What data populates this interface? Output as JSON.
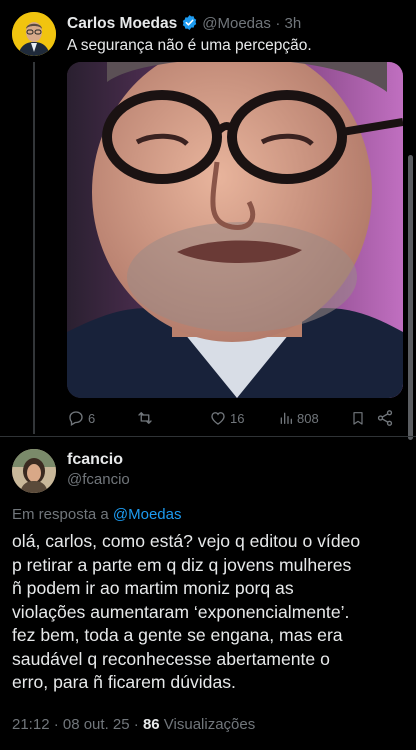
{
  "tweet": {
    "author_name": "Carlos Moedas",
    "author_handle": "@Moedas",
    "time": "· 3h",
    "text": "A segurança não é uma percepção.",
    "media_icon": "volume-muted-icon",
    "actions": {
      "replies": "6",
      "retweets": "",
      "likes": "16",
      "views": "808"
    }
  },
  "reply": {
    "author_name": "fcancio",
    "author_handle": "@fcancio",
    "in_reply_prefix": "Em resposta a",
    "in_reply_handle": "@Moedas",
    "lines": [
      "olá, carlos, como está? vejo q editou o vídeo",
      "p retirar a parte em q diz q jovens mulheres",
      "ñ podem ir ao martim moniz porq as",
      "violações aumentaram ‘exponencialmente’.",
      "fez bem, toda a gente se engana, mas era",
      "saudável q reconhecesse abertamente o",
      "erro, para ñ ficarem dúvidas."
    ],
    "timestamp": "21:12 · 08 out. 25 ·",
    "views_count": "86",
    "views_label": "Visualizações"
  },
  "colors": {
    "background": "#000000",
    "accent": "#1d9bf0",
    "secondary_text": "#71767b"
  }
}
